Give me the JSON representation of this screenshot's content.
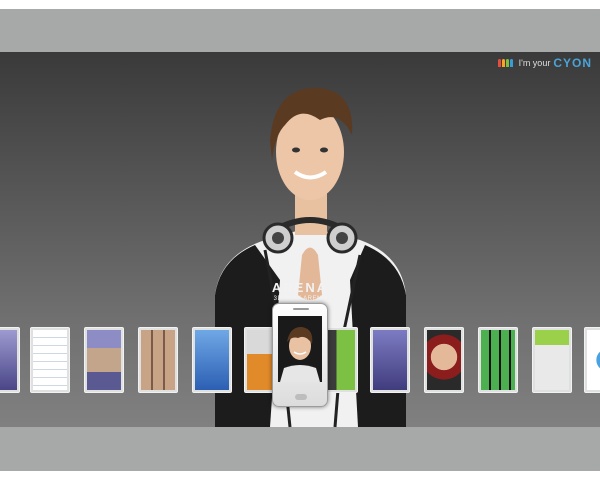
{
  "brand": {
    "tagline": "I'm your",
    "logo": "CYON",
    "logo_color": "#4aa3d8",
    "people_icon": "people-icon"
  },
  "product": {
    "name": "ARENA",
    "slogan": "3D PLAY ARENA"
  },
  "carousel": {
    "selected_index": 6,
    "items": [
      {
        "id": "home-screen",
        "icon": "widget-screen-icon"
      },
      {
        "id": "contacts-list",
        "icon": "contacts-list-icon"
      },
      {
        "id": "photo-viewer",
        "icon": "photo-viewer-icon"
      },
      {
        "id": "photo-gallery",
        "icon": "photo-gallery-icon"
      },
      {
        "id": "app-menu",
        "icon": "app-menu-icon"
      },
      {
        "id": "clock-widget",
        "icon": "clock-widget-icon"
      },
      {
        "id": "selected-phone",
        "icon": "portrait-wallpaper-icon"
      },
      {
        "id": "cube-3d",
        "icon": "cube-3d-icon"
      },
      {
        "id": "media-grid",
        "icon": "media-grid-icon"
      },
      {
        "id": "wallpaper",
        "icon": "wallpaper-icon"
      },
      {
        "id": "app-icons",
        "icon": "app-icons-grid-icon"
      },
      {
        "id": "dialer",
        "icon": "dialer-keypad-icon"
      },
      {
        "id": "browser",
        "icon": "browser-icon"
      }
    ]
  }
}
